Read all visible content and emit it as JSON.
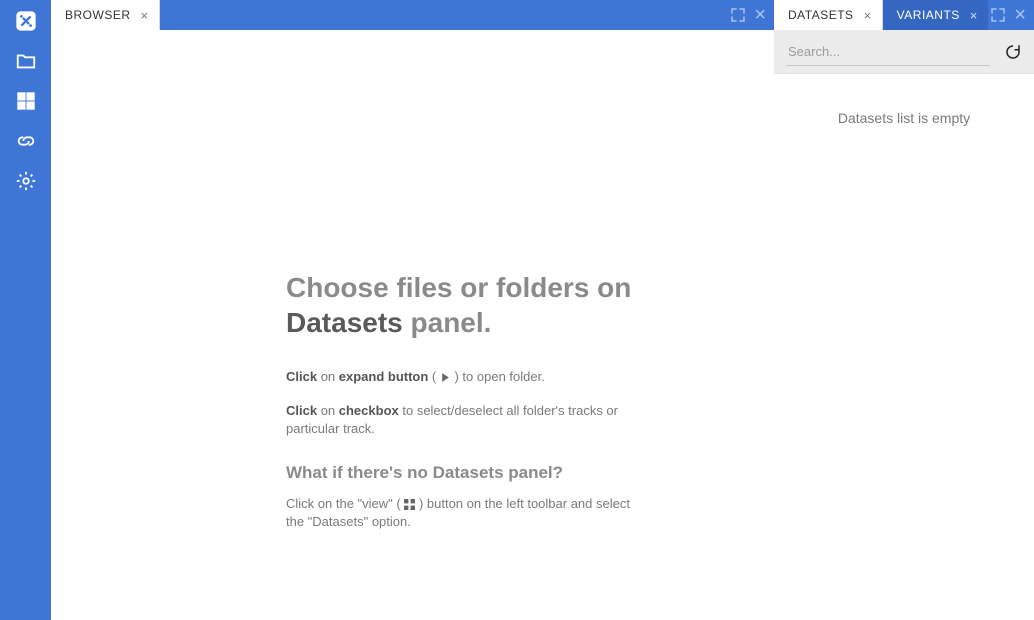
{
  "toolbar": {
    "icons": [
      "logo",
      "folder",
      "view",
      "link",
      "settings"
    ]
  },
  "main": {
    "tab_label": "BROWSER",
    "empty": {
      "heading_pre": "Choose files or folders on ",
      "heading_em": "Datasets",
      "heading_post": " panel.",
      "line1_b1": "Click",
      "line1_mid": " on ",
      "line1_b2": "expand button",
      "line1_post": " ( ",
      "line1_end": " ) to open folder.",
      "line2_b1": "Click",
      "line2_mid": " on ",
      "line2_b2": "checkbox",
      "line2_post": " to select/deselect all folder's tracks or particular track.",
      "subhead": "What if there's no Datasets panel?",
      "line3_pre": "Click on the \"view\" ( ",
      "line3_post": " ) button on the left toolbar and select the \"Datasets\" option."
    }
  },
  "right": {
    "tab1_label": "DATASETS",
    "tab2_label": "VARIANTS",
    "search_placeholder": "Search...",
    "empty_msg": "Datasets list is empty"
  }
}
